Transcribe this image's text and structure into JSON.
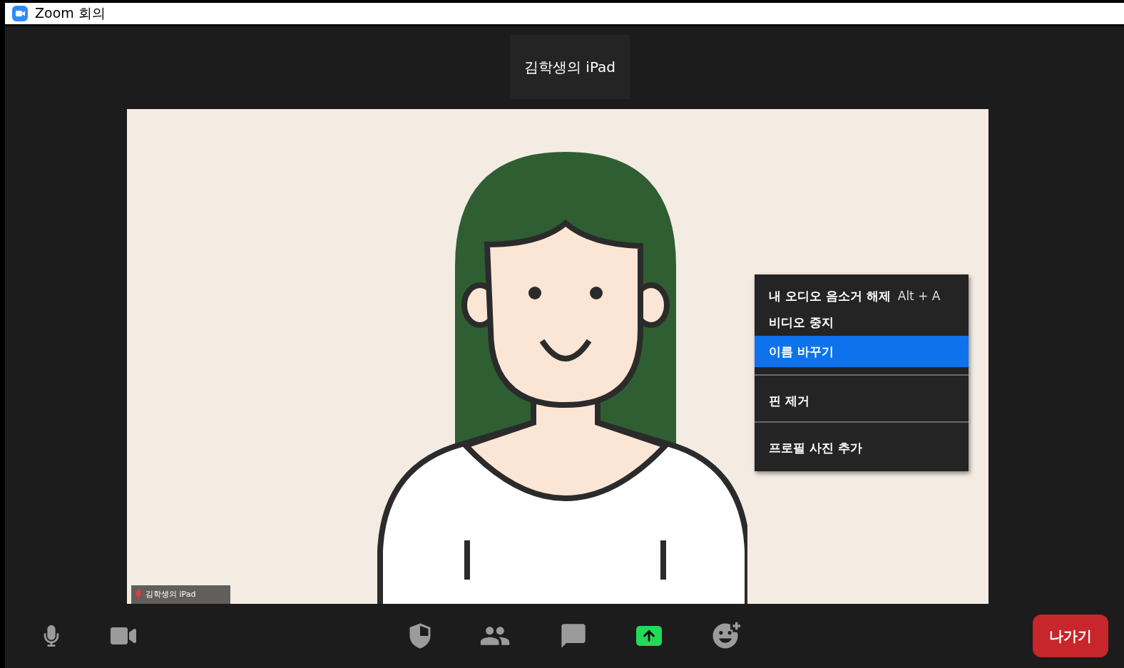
{
  "window": {
    "title": "Zoom 회의"
  },
  "speaker": {
    "name": "김학생의 iPad"
  },
  "video_tile": {
    "name": "김학생의 iPad",
    "muted": true
  },
  "context_menu": {
    "sections": [
      {
        "items": [
          {
            "label": "내 오디오 음소거 해제",
            "shortcut": "Alt + A",
            "selected": false
          },
          {
            "label": "비디오 중지",
            "selected": false
          },
          {
            "label": "이름 바꾸기",
            "selected": true
          }
        ]
      },
      {
        "items": [
          {
            "label": "핀 제거",
            "selected": false
          }
        ]
      },
      {
        "items": [
          {
            "label": "프로필 사진 추가",
            "selected": false
          }
        ]
      }
    ]
  },
  "toolbar": {
    "leave_button": "나가기"
  }
}
